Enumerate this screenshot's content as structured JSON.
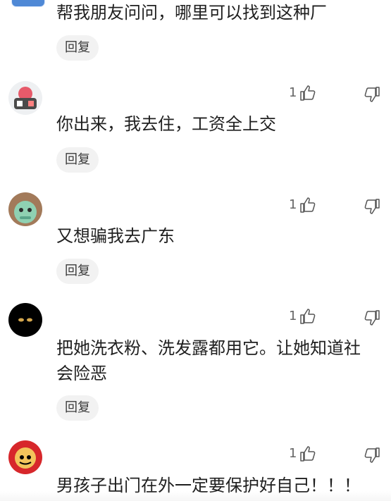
{
  "comments": [
    {
      "text": "帮我朋友问问，哪里可以找到这种厂",
      "reply_label": "回复"
    },
    {
      "likes": "1",
      "text": "你出来，我去住，工资全上交",
      "reply_label": "回复"
    },
    {
      "likes": "1",
      "text": "又想骗我去广东",
      "reply_label": "回复"
    },
    {
      "likes": "1",
      "text": "把她洗衣粉、洗发露都用它。让她知道社会险恶",
      "reply_label": "回复"
    },
    {
      "likes": "1",
      "text": "男孩子出门在外一定要保护好自己！！！"
    }
  ],
  "icons": {
    "like": "thumbs-up-icon",
    "dislike": "thumbs-down-icon"
  },
  "colors": {
    "reply_bg": "#f2f2f2",
    "text": "#1f1f1f",
    "muted": "#666666"
  }
}
